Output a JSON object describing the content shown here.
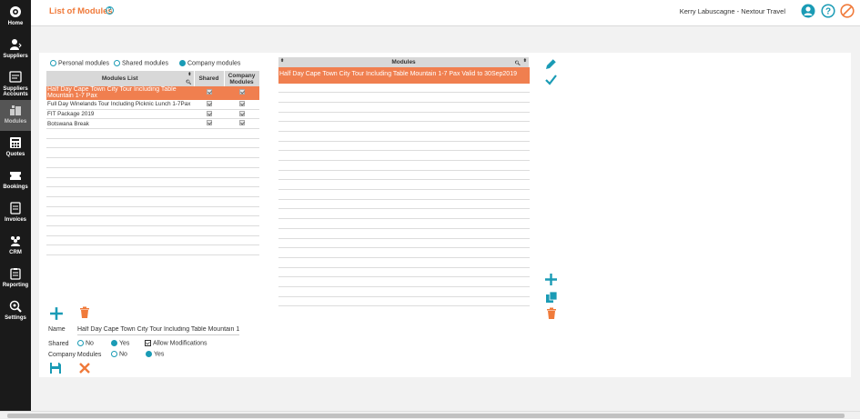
{
  "sidebar": {
    "items": [
      {
        "label": "Home",
        "icon": "home-icon"
      },
      {
        "label": "Suppliers",
        "icon": "supplier-icon"
      },
      {
        "label": "Suppliers Accounts",
        "icon": "accounts-icon"
      },
      {
        "label": "Modules",
        "icon": "modules-icon",
        "active": true
      },
      {
        "label": "Quotes",
        "icon": "calculator-icon"
      },
      {
        "label": "Bookings",
        "icon": "ticket-icon"
      },
      {
        "label": "Invoices",
        "icon": "invoice-icon"
      },
      {
        "label": "CRM",
        "icon": "people-icon"
      },
      {
        "label": "Reporting",
        "icon": "clipboard-icon"
      },
      {
        "label": "Settings",
        "icon": "settings-icon"
      }
    ]
  },
  "header": {
    "title": "List of Modules",
    "user": "Kerry Labuscagne - Nextour Travel"
  },
  "filters": {
    "personal": "Personal modules",
    "shared": "Shared modules",
    "company": "Company modules",
    "selected": "company"
  },
  "modules_list": {
    "headers": {
      "name": "Modules List",
      "shared": "Shared",
      "company": "Company Modules"
    },
    "rows": [
      {
        "name": "Half Day Cape Town City Tour Including Table Mountain 1-7 Pax",
        "shared": true,
        "company": true,
        "selected": true
      },
      {
        "name": "Full Day Winelands Tour Including Picknic Lunch 1-7Pax",
        "shared": true,
        "company": true
      },
      {
        "name": "FIT Package 2019",
        "shared": true,
        "company": true
      },
      {
        "name": "Botswana Break",
        "shared": true,
        "company": true
      }
    ]
  },
  "modules_detail": {
    "header": "Modules",
    "rows": [
      "Half Day Cape Town City Tour Including Table Mountain 1-7 Pax Valid to 30Sep2019"
    ]
  },
  "form": {
    "name_label": "Name",
    "name_value": "Half Day Cape Town City Tour Including Table Mountain 1-7 Pax",
    "shared_label": "Shared",
    "no_label": "No",
    "yes_label": "Yes",
    "allow_label": "Allow Modifications",
    "company_label": "Company Modules",
    "shared_value": "yes",
    "company_value": "yes",
    "allow_modifications": true
  },
  "colors": {
    "accent": "#1a9bb5",
    "orange": "#f07a3a",
    "selected_row": "#f07f4f"
  }
}
